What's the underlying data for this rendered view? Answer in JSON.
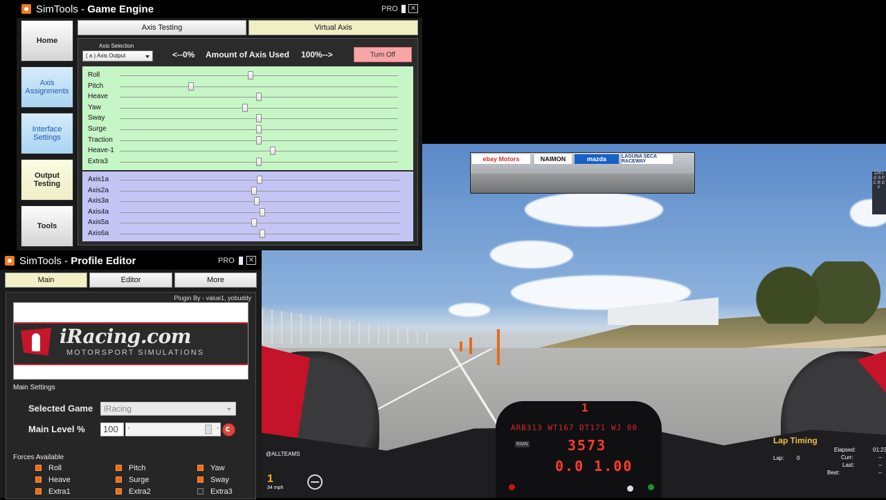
{
  "game_engine": {
    "title_prefix": "SimTools - ",
    "title_bold": "Game Engine",
    "pro_label": "PRO",
    "close_glyph": "✕",
    "nav": [
      {
        "label": "Home"
      },
      {
        "label": "Axis Assignments"
      },
      {
        "label": "Interface Settings"
      },
      {
        "label": "Output Testing"
      },
      {
        "label": "Tools"
      }
    ],
    "tabs": [
      {
        "label": "Axis Testing"
      },
      {
        "label": "Virtual Axis"
      }
    ],
    "axis_selection_label": "Axis Selection",
    "axis_selection_value": "( a ) Axis Output",
    "amount_left": "<--0%",
    "amount_label": "Amount of Axis Used",
    "amount_right": "100%-->",
    "turn_off_label": "Turn Off",
    "green_axes": [
      {
        "label": "Roll",
        "value": 0.47
      },
      {
        "label": "Pitch",
        "value": 0.255
      },
      {
        "label": "Heave",
        "value": 0.5
      },
      {
        "label": "Yaw",
        "value": 0.45
      },
      {
        "label": "Sway",
        "value": 0.5
      },
      {
        "label": "Surge",
        "value": 0.5
      },
      {
        "label": "Traction",
        "value": 0.5
      },
      {
        "label": "Heave-1",
        "value": 0.55
      },
      {
        "label": "Extra3",
        "value": 0.5
      }
    ],
    "purple_axes": [
      {
        "label": "Axis1a",
        "value": 0.5
      },
      {
        "label": "Axis2a",
        "value": 0.48
      },
      {
        "label": "Axis3a",
        "value": 0.49
      },
      {
        "label": "Axis4a",
        "value": 0.51
      },
      {
        "label": "Axis5a",
        "value": 0.48
      },
      {
        "label": "Axis6a",
        "value": 0.51
      }
    ]
  },
  "profile_editor": {
    "title_prefix": "SimTools - ",
    "title_bold": "Profile Editor",
    "pro_label": "PRO",
    "close_glyph": "✕",
    "tabs": [
      {
        "label": "Main"
      },
      {
        "label": "Editor"
      },
      {
        "label": "More"
      }
    ],
    "plugin_by": "Plugin By - value1, yobuddy",
    "logo_text": "iRacing.com",
    "logo_sub": "MOTORSPORT SIMULATIONS",
    "main_settings_label": "Main Settings",
    "selected_game_label": "Selected Game",
    "selected_game_value": "iRacing",
    "main_level_label": "Main Level %",
    "main_level_value": "100",
    "slider_left_arrow": "‹",
    "slider_right_arrow": "›",
    "forces_label": "Forces Available",
    "forces": [
      {
        "label": "Roll",
        "checked": true
      },
      {
        "label": "Pitch",
        "checked": true
      },
      {
        "label": "Yaw",
        "checked": true
      },
      {
        "label": "Heave",
        "checked": true
      },
      {
        "label": "Surge",
        "checked": true
      },
      {
        "label": "Sway",
        "checked": true
      },
      {
        "label": "Extra1",
        "checked": true
      },
      {
        "label": "Extra2",
        "checked": true
      },
      {
        "label": "Extra3",
        "checked": false
      }
    ]
  },
  "game": {
    "mirror_banners": [
      "ebay Motors",
      "NAIMON",
      "mazda",
      "LAGUNA SECA RACEWAY"
    ],
    "dash_rpm": "ARB313 WT167 DT171 WJ 00",
    "dash_gear": "1",
    "dash_speed": "3573",
    "dash_lower": "0.0 1.00",
    "dash_button": "RAIN",
    "team_label": "@ALLTEAMS",
    "gear_indicator": "1",
    "speed_readout": "34 mph",
    "lap_timing_title": "Lap Timing",
    "lap_label": "Lap:",
    "lap_value": "0",
    "elapsed_label": "Elapsed:",
    "elapsed_value": "01:23",
    "curr_label": "Curr:",
    "curr_value": "--",
    "last_label": "Last:",
    "last_value": "--",
    "best_label": "Best:",
    "best_value": "--",
    "side_ticker": "124 L G S P C R G F"
  }
}
